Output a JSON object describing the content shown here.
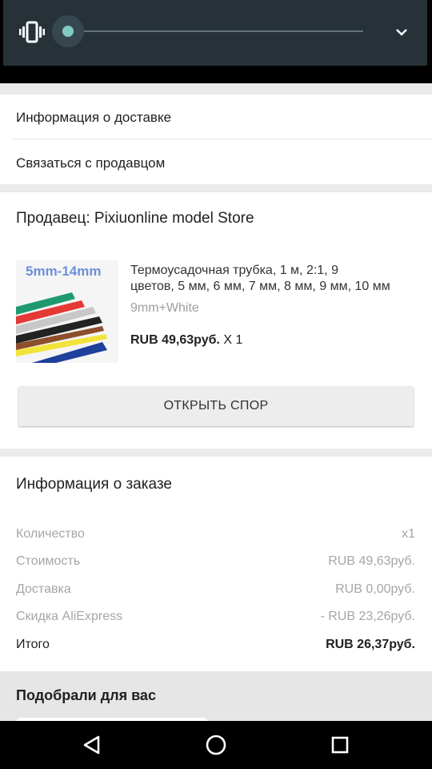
{
  "volume": {
    "icon": "vibrate-icon",
    "level": 0.0,
    "expand_icon": "chevron-down-icon",
    "accent_color": "#80cbc4"
  },
  "links": {
    "delivery_info": "Информация о доставке",
    "contact_seller": "Связаться с продавцом"
  },
  "seller": {
    "name": "Продавец: Pixiuonline model Store"
  },
  "product": {
    "image_caption": "5mm-14mm",
    "title_line1": "Термоусадочная трубка, 1 м, 2:1, 9",
    "title_line2": "цветов, 5 мм, 6 мм, 7 мм, 8 мм, 9 мм, 10 мм",
    "variant": "9mm+White",
    "price": "RUB 49,63руб.",
    "quantity": "X 1",
    "dispute_button": "ОТКРЫТЬ СПОР"
  },
  "order": {
    "title": "Информация о заказе",
    "rows": [
      {
        "label": "Количество",
        "value": "x1"
      },
      {
        "label": "Стоимость",
        "value": "RUB 49,63руб."
      },
      {
        "label": "Доставка",
        "value": "RUB 0,00руб."
      },
      {
        "label": "Скидка AliExpress",
        "value": "- RUB 23,26руб."
      },
      {
        "label": "Итого",
        "value": "RUB 26,37руб."
      }
    ]
  },
  "recommend": {
    "title": "Подобрали для вас"
  },
  "navbar": {
    "back_icon": "back-triangle-icon",
    "home_icon": "home-circle-icon",
    "recents_icon": "recents-square-icon"
  }
}
